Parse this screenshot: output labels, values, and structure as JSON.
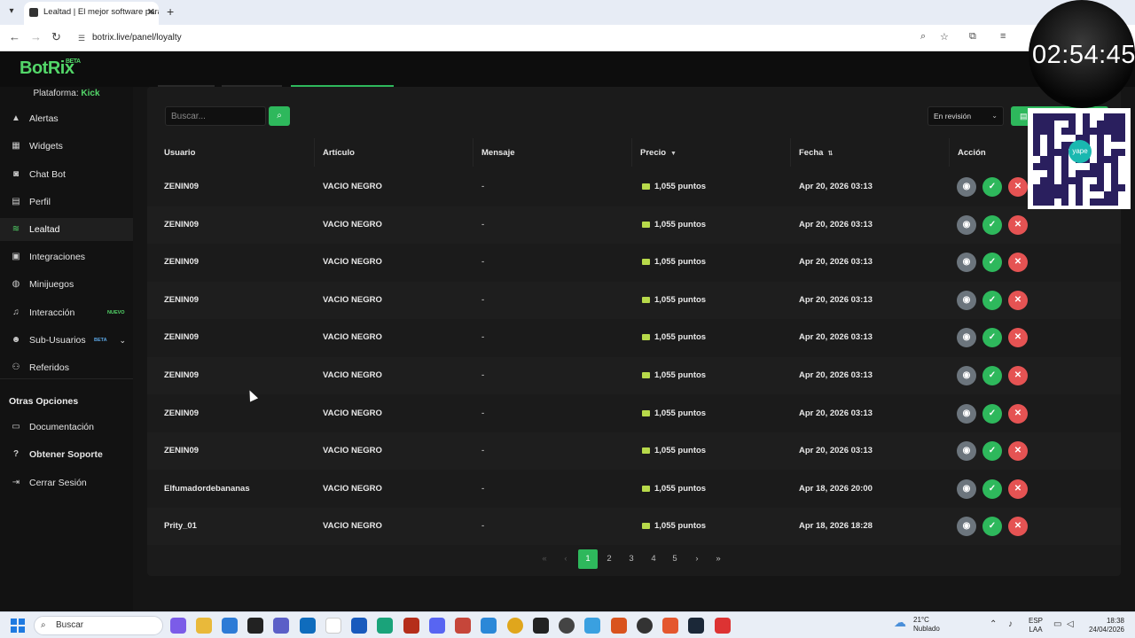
{
  "browser": {
    "tab_title": "Lealtad | El mejor software para",
    "url": "botrix.live/panel/loyalty"
  },
  "header": {
    "logo": "BotRix",
    "logo_badge": "BETA"
  },
  "sidebar": {
    "platform_label": "Plataforma:",
    "platform_value": "Kick",
    "items": [
      {
        "label": "Alertas",
        "icon": "alert-icon"
      },
      {
        "label": "Widgets",
        "icon": "widgets-icon"
      },
      {
        "label": "Chat Bot",
        "icon": "robot-icon"
      },
      {
        "label": "Perfil",
        "icon": "profile-icon"
      },
      {
        "label": "Lealtad",
        "icon": "coins-icon",
        "active": true
      },
      {
        "label": "Integraciones",
        "icon": "integrations-icon"
      },
      {
        "label": "Minijuegos",
        "icon": "gamepad-icon"
      },
      {
        "label": "Interacción",
        "icon": "music-icon",
        "badge": "NUEVO"
      },
      {
        "label": "Sub-Usuarios",
        "icon": "users-icon",
        "badge": "BETA"
      },
      {
        "label": "Referidos",
        "icon": "referrals-icon"
      }
    ],
    "other_title": "Otras Opciones",
    "other_items": [
      {
        "label": "Documentación",
        "icon": "document-icon"
      },
      {
        "label": "Obtener Soporte",
        "icon": "support-icon"
      },
      {
        "label": "Cerrar Sesión",
        "icon": "logout-icon"
      }
    ]
  },
  "toolbar": {
    "search_placeholder": "Buscar...",
    "filter_value": "En revisión"
  },
  "table": {
    "columns": [
      "Usuario",
      "Artículo",
      "Mensaje",
      "Precio",
      "Fecha",
      "Acción"
    ],
    "rows": [
      {
        "user": "ZENIN09",
        "item": "VACIO NEGRO",
        "message": "-",
        "price": "1,055 puntos",
        "date": "Apr 20, 2026 03:13"
      },
      {
        "user": "ZENIN09",
        "item": "VACIO NEGRO",
        "message": "-",
        "price": "1,055 puntos",
        "date": "Apr 20, 2026 03:13"
      },
      {
        "user": "ZENIN09",
        "item": "VACIO NEGRO",
        "message": "-",
        "price": "1,055 puntos",
        "date": "Apr 20, 2026 03:13"
      },
      {
        "user": "ZENIN09",
        "item": "VACIO NEGRO",
        "message": "-",
        "price": "1,055 puntos",
        "date": "Apr 20, 2026 03:13"
      },
      {
        "user": "ZENIN09",
        "item": "VACIO NEGRO",
        "message": "-",
        "price": "1,055 puntos",
        "date": "Apr 20, 2026 03:13"
      },
      {
        "user": "ZENIN09",
        "item": "VACIO NEGRO",
        "message": "-",
        "price": "1,055 puntos",
        "date": "Apr 20, 2026 03:13"
      },
      {
        "user": "ZENIN09",
        "item": "VACIO NEGRO",
        "message": "-",
        "price": "1,055 puntos",
        "date": "Apr 20, 2026 03:13"
      },
      {
        "user": "ZENIN09",
        "item": "VACIO NEGRO",
        "message": "-",
        "price": "1,055 puntos",
        "date": "Apr 20, 2026 03:13"
      },
      {
        "user": "Elfumadordebananas",
        "item": "VACIO NEGRO",
        "message": "-",
        "price": "1,055 puntos",
        "date": "Apr 18, 2026 20:00"
      },
      {
        "user": "Prity_01",
        "item": "VACIO NEGRO",
        "message": "-",
        "price": "1,055 puntos",
        "date": "Apr 18, 2026 18:28"
      }
    ]
  },
  "pagination": {
    "pages": [
      "1",
      "2",
      "3",
      "4",
      "5"
    ],
    "current": "1"
  },
  "overlay": {
    "timer": "02:54:45",
    "qr_brand": "yape"
  },
  "taskbar": {
    "search_placeholder": "Buscar",
    "weather_temp": "21°C",
    "weather_desc": "Nublado",
    "lang_1": "ESP",
    "lang_2": "LAA",
    "time": "18:38",
    "date": "24/04/2026"
  },
  "colors": {
    "accent": "#2eb85c",
    "danger": "#e55353",
    "neutral": "#6c757d",
    "background": "#151515"
  }
}
